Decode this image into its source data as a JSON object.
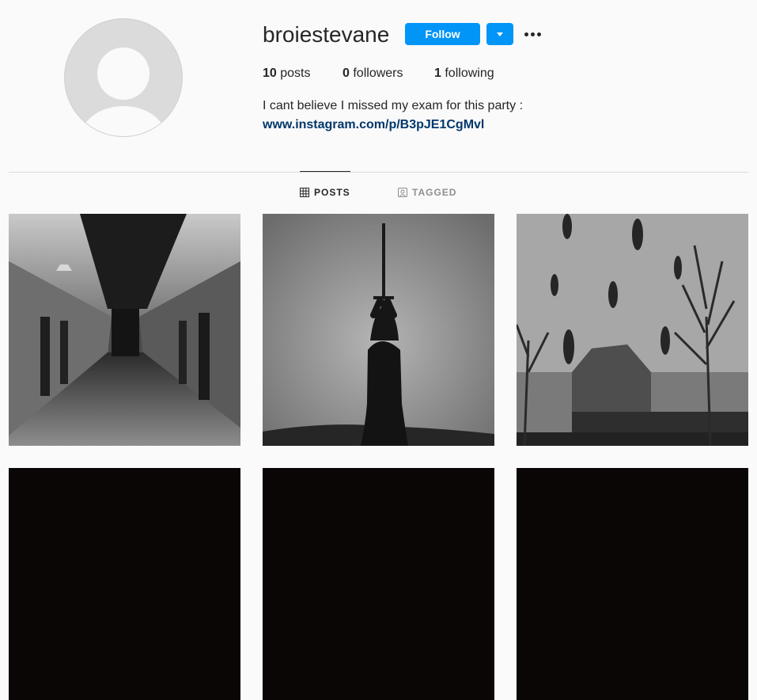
{
  "profile": {
    "username": "broiestevane",
    "follow_label": "Follow",
    "stats": {
      "posts_count": "10",
      "posts_label": "posts",
      "followers_count": "0",
      "followers_label": "followers",
      "following_count": "1",
      "following_label": "following"
    },
    "bio": "I cant believe I missed my exam for this party :",
    "bio_link": "www.instagram.com/p/B3pJE1CgMvl"
  },
  "tabs": [
    {
      "label": "POSTS",
      "icon": "grid-icon",
      "active": true
    },
    {
      "label": "TAGGED",
      "icon": "tagged-icon",
      "active": false
    }
  ],
  "posts": [
    {
      "description": "prison-corridor",
      "tone": "grayscale"
    },
    {
      "description": "figure-raising-sword",
      "tone": "grayscale"
    },
    {
      "description": "floating-figures-foggy-house",
      "tone": "grayscale"
    },
    {
      "description": "dark",
      "tone": "black"
    },
    {
      "description": "dark",
      "tone": "black"
    },
    {
      "description": "dark",
      "tone": "black"
    }
  ],
  "colors": {
    "accent": "#0095f6",
    "link": "#00376b",
    "background": "#fafafa",
    "text": "#262626",
    "muted": "#8e8e8e"
  }
}
